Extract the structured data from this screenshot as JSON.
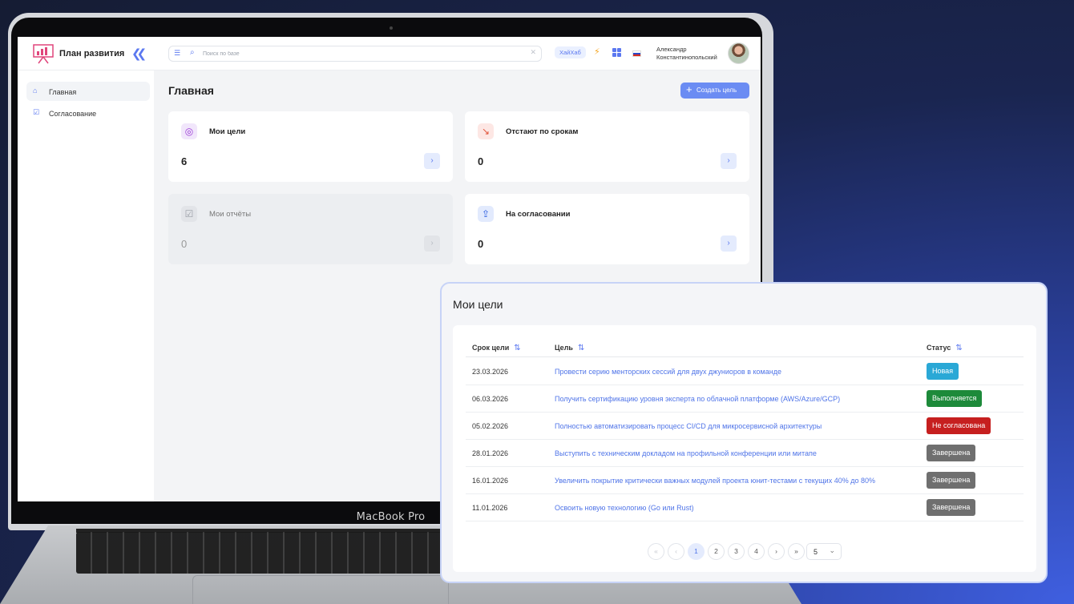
{
  "app": {
    "title": "План развития",
    "search_placeholder": "Поиск по базе",
    "hub_label": "ХайХаб",
    "user_name_line1": "Александр",
    "user_name_line2": "Константинопольский"
  },
  "sidebar": {
    "items": [
      {
        "label": "Главная",
        "icon": "home-icon",
        "active": true
      },
      {
        "label": "Согласование",
        "icon": "checkbox-icon",
        "active": false
      }
    ]
  },
  "main": {
    "title": "Главная",
    "create_label": "Создать цель",
    "cards": [
      {
        "title": "Мои цели",
        "value": "6",
        "icon": "target-icon"
      },
      {
        "title": "Отстают по срокам",
        "value": "0",
        "icon": "trend-down-icon"
      },
      {
        "title": "Мои отчёты",
        "value": "0",
        "icon": "checklist-icon"
      },
      {
        "title": "На согласовании",
        "value": "0",
        "icon": "document-upload-icon"
      }
    ]
  },
  "device": {
    "label": "MacBook Pro"
  },
  "goals_panel": {
    "title": "Мои цели",
    "columns": {
      "deadline": "Срок цели",
      "goal": "Цель",
      "status": "Статус"
    },
    "rows": [
      {
        "date": "23.03.2026",
        "goal": "Провести серию менторских сессий для двух джуниоров в команде",
        "status": "Новая",
        "status_color": "#2aa8d6"
      },
      {
        "date": "06.03.2026",
        "goal": "Получить сертификацию уровня эксперта по облачной платформе (AWS/Azure/GCP)",
        "status": "Выполняется",
        "status_color": "#1d8a3a"
      },
      {
        "date": "05.02.2026",
        "goal": "Полностью автоматизировать процесс CI/CD для микросервисной архитектуры",
        "status": "Не согласована",
        "status_color": "#c61f1f"
      },
      {
        "date": "28.01.2026",
        "goal": "Выступить с техническим докладом на профильной конференции или митапе",
        "status": "Завершена",
        "status_color": "#6f6f6f"
      },
      {
        "date": "16.01.2026",
        "goal": "Увеличить покрытие критически важных модулей проекта юнит-тестами с текущих 40% до 80%",
        "status": "Завершена",
        "status_color": "#6f6f6f"
      },
      {
        "date": "11.01.2026",
        "goal": "Освоить новую технологию (Go или Rust)",
        "status": "Завершена",
        "status_color": "#6f6f6f"
      }
    ],
    "pagination": {
      "first": "«",
      "prev": "‹",
      "pages": [
        "1",
        "2",
        "3",
        "4"
      ],
      "current": "1",
      "next": "›",
      "last": "»",
      "page_size": "5"
    }
  },
  "colors": {
    "accent": "#5b78f0",
    "primary_button": "#6b8cf3"
  }
}
